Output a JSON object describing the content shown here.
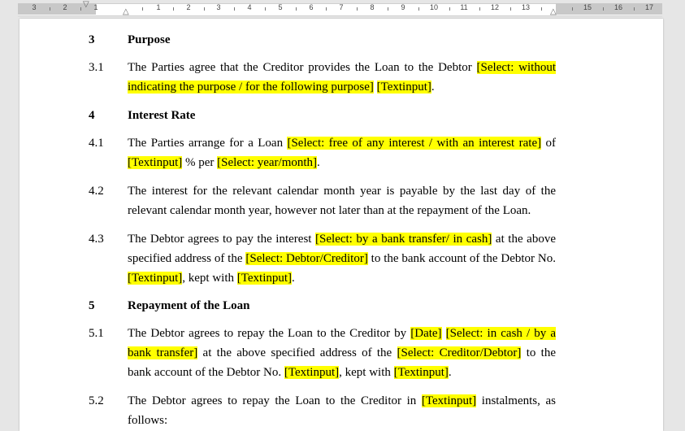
{
  "ruler": {
    "left_numbers": [
      "3",
      "2",
      "1"
    ],
    "right_numbers": [
      "1",
      "2",
      "3",
      "4",
      "5",
      "6",
      "7",
      "8",
      "9",
      "10",
      "11",
      "12",
      "13",
      "15",
      "16",
      "17"
    ]
  },
  "document": {
    "s3": {
      "num": "3",
      "title": "Purpose"
    },
    "s3_1": {
      "num": "3.1",
      "t1": "The Parties agree that the Creditor provides the Loan to the Debtor ",
      "h1": "[Select: without indicating the purpose / for the following purpose]",
      "t2": " ",
      "h2": "[Textinput]",
      "t3": "."
    },
    "s4": {
      "num": "4",
      "title": "Interest Rate"
    },
    "s4_1": {
      "num": "4.1",
      "t1": "The Parties arrange for a Loan ",
      "h1": "[Select: free of any interest / with an interest rate]",
      "t2": " of ",
      "h2": "[Textinput]",
      "t3": " % per ",
      "h3": "[Select: year/month]",
      "t4": "."
    },
    "s4_2": {
      "num": "4.2",
      "text": "The interest for the relevant calendar month year is payable by the last day of the relevant calendar month year, however not later than at the repayment of the Loan."
    },
    "s4_3": {
      "num": "4.3",
      "t1": "The Debtor agrees to pay the interest ",
      "h1": "[Select: by a bank transfer/ in cash]",
      "t2": " at the above specified address of the ",
      "h2": "[Select: Debtor/Creditor]",
      "t3": " to the bank account of the Debtor No. ",
      "h3": "[Textinput]",
      "t4": ", kept with ",
      "h4": "[Textinput]",
      "t5": "."
    },
    "s5": {
      "num": "5",
      "title": "Repayment of the Loan"
    },
    "s5_1": {
      "num": "5.1",
      "t1": "The Debtor agrees to repay the Loan to the Creditor by ",
      "h1": "[Date]",
      "t2": " ",
      "h2": "[Select: in cash / by a bank transfer]",
      "t3": " at the above specified address of the ",
      "h3": "[Select: Creditor/Debtor]",
      "t4": " to the bank account of the Debtor No. ",
      "h4": "[Textinput]",
      "t5": ", kept with ",
      "h5": "[Textinput]",
      "t6": "."
    },
    "s5_2": {
      "num": "5.2",
      "t1": "The Debtor agrees to repay the Loan to the Creditor in ",
      "h1": "[Textinput]",
      "t2": " instalments, as follows:"
    }
  }
}
